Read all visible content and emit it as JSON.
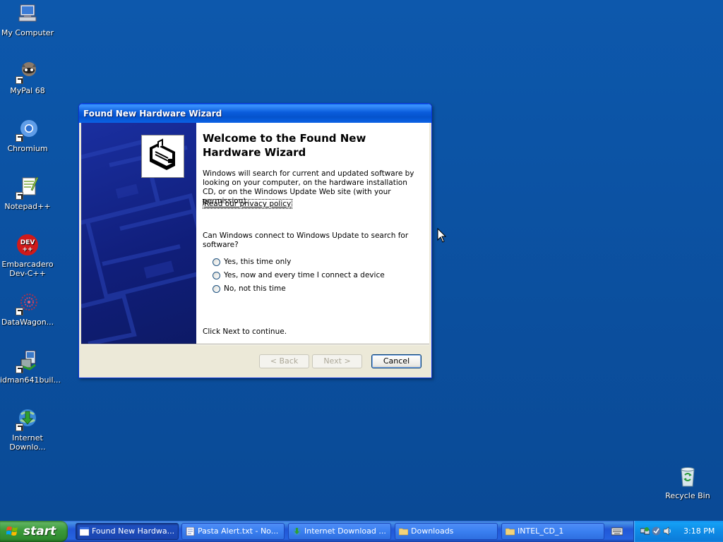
{
  "desktop": {
    "icons": [
      {
        "label": "My Computer",
        "icon": "my-computer-icon"
      },
      {
        "label": "MyPal 68",
        "icon": "mypal-icon"
      },
      {
        "label": "Chromium",
        "icon": "chromium-icon"
      },
      {
        "label": "Notepad++",
        "icon": "notepadpp-icon"
      },
      {
        "label": "Embarcadero\nDev-C++",
        "icon": "devcpp-icon"
      },
      {
        "label": "DataWagon...",
        "icon": "datawagon-icon"
      },
      {
        "label": "idman641buil...",
        "icon": "idm-installer-icon"
      },
      {
        "label": "Internet\nDownlo...",
        "icon": "internet-download-manager-icon"
      },
      {
        "label": "Recycle Bin",
        "icon": "recycle-bin-icon"
      }
    ]
  },
  "wizard": {
    "title": "Found New Hardware Wizard",
    "heading": "Welcome to the Found New Hardware Wizard",
    "description": "Windows will search for current and updated software by looking on your computer, on the hardware installation CD, or on the Windows Update Web site (with your permission).",
    "privacy_link": "Read our privacy policy",
    "question": "Can Windows connect to Windows Update to search for software?",
    "options": [
      "Yes, this time only",
      "Yes, now and every time I connect a device",
      "No, not this time"
    ],
    "continue_hint": "Click Next to continue.",
    "buttons": {
      "back": "< Back",
      "next": "Next >",
      "cancel": "Cancel"
    }
  },
  "taskbar": {
    "start_label": "start",
    "tasks": [
      {
        "label": "Found New Hardwa...",
        "active": true
      },
      {
        "label": "Pasta Alert.txt - No..."
      },
      {
        "label": "Internet Download ..."
      },
      {
        "label": "Downloads"
      },
      {
        "label": "INTEL_CD_1"
      }
    ],
    "clock": "3:18 PM"
  },
  "colors": {
    "desktop": "#0c4fa0",
    "titlebar": "#0553cc",
    "start": "#3a9a3a",
    "tray": "#0e8be6"
  }
}
